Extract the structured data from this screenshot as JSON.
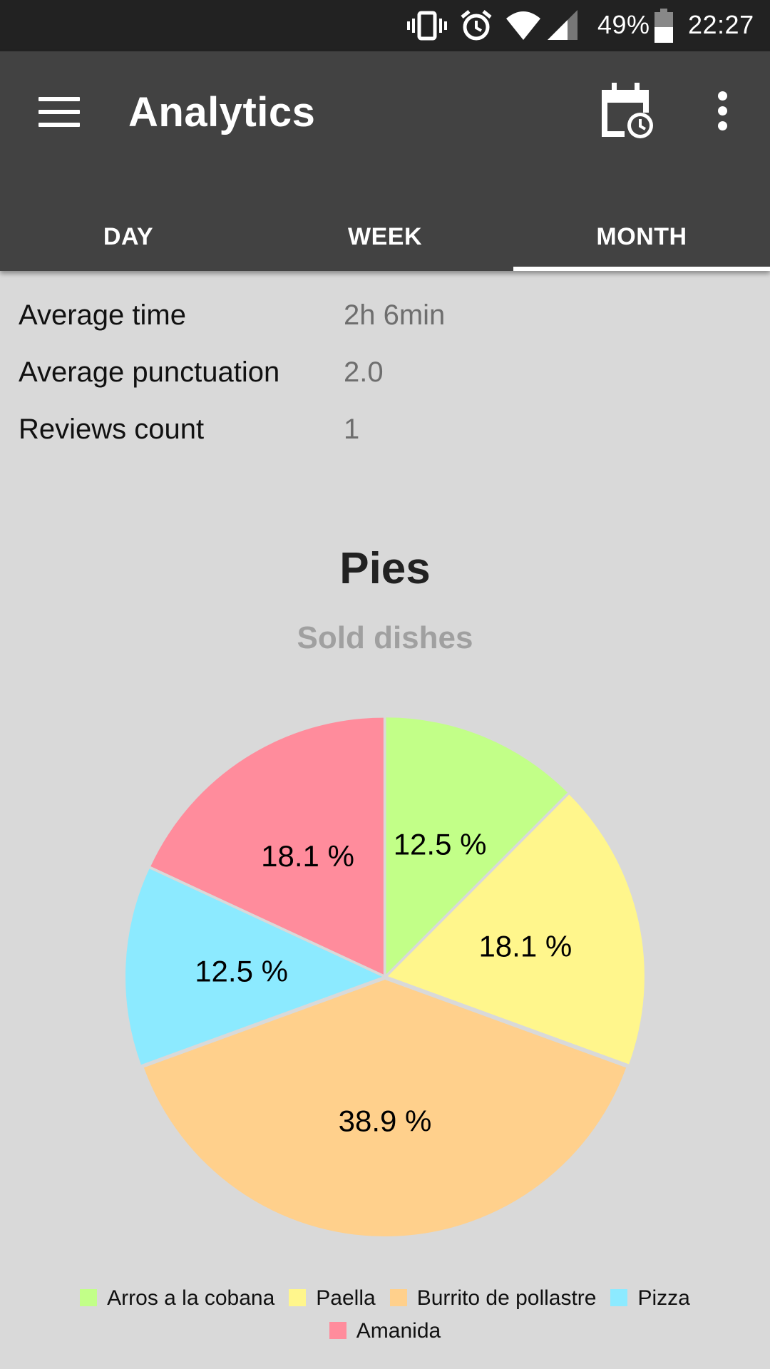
{
  "status_bar": {
    "battery": "49%",
    "time": "22:27",
    "icons": [
      "vibrate-icon",
      "alarm-icon",
      "wifi-icon",
      "signal-icon",
      "battery-icon"
    ]
  },
  "app_bar": {
    "title": "Analytics",
    "menu_icon": "menu-icon",
    "calendar_icon": "calendar-clock-icon",
    "more_icon": "more-vert-icon",
    "background": "#424242",
    "tabs": [
      {
        "label": "DAY",
        "selected": false
      },
      {
        "label": "WEEK",
        "selected": false
      },
      {
        "label": "MONTH",
        "selected": true
      }
    ]
  },
  "stats": [
    {
      "label": "Average time",
      "value": "2h 6min"
    },
    {
      "label": "Average punctuation",
      "value": "2.0"
    },
    {
      "label": "Reviews count",
      "value": "1"
    }
  ],
  "section": {
    "title": "Pies",
    "subtitle": "Sold dishes"
  },
  "chart_data": {
    "type": "pie",
    "title": "Pies",
    "subtitle": "Sold dishes",
    "legend_position": "bottom",
    "slices": [
      {
        "name": "Arros a la cobana",
        "value": 12.5,
        "label": "12.5 %",
        "color": "#c2ff88"
      },
      {
        "name": "Paella",
        "value": 18.1,
        "label": "18.1 %",
        "color": "#fff68c"
      },
      {
        "name": "Burrito de pollastre",
        "value": 38.9,
        "label": "38.9 %",
        "color": "#ffd08c"
      },
      {
        "name": "Pizza",
        "value": 12.5,
        "label": "12.5 %",
        "color": "#8ceaff"
      },
      {
        "name": "Amanida",
        "value": 18.1,
        "label": "18.1 %",
        "color": "#ff8c9c"
      }
    ]
  }
}
